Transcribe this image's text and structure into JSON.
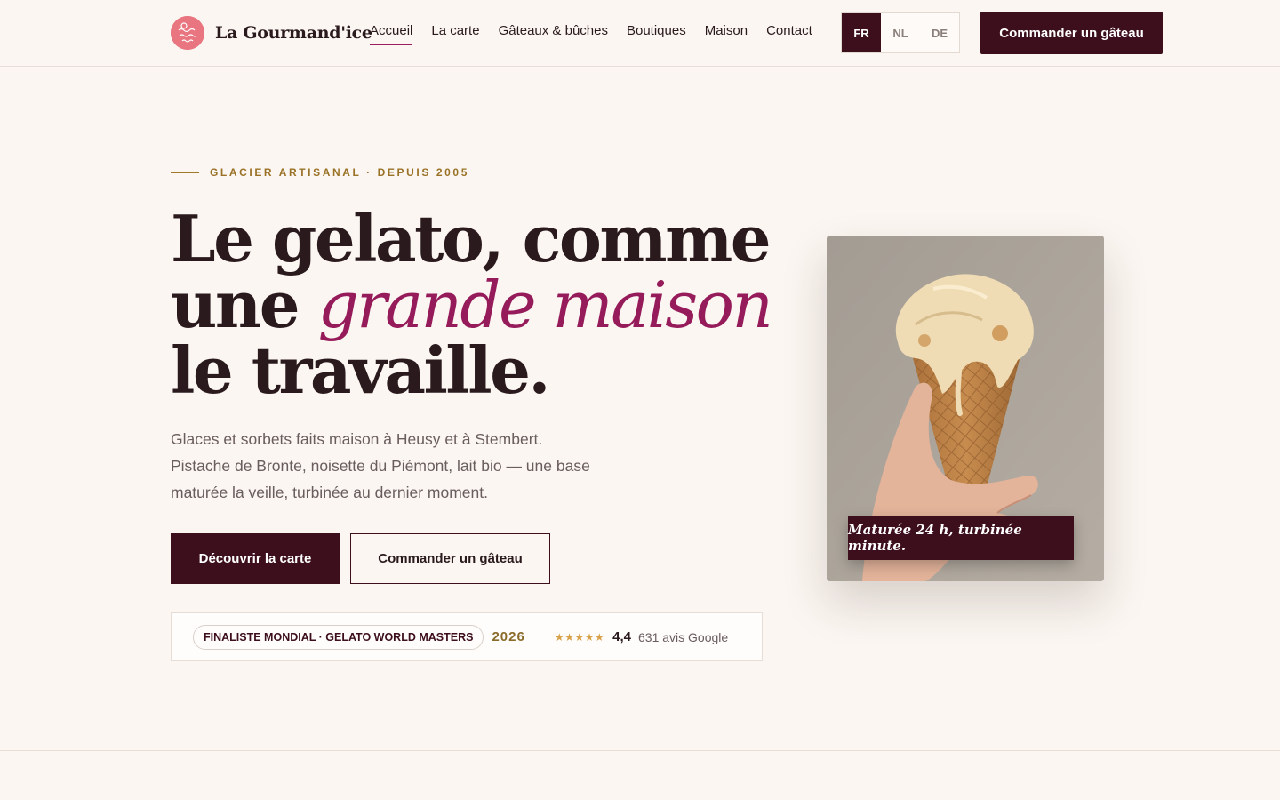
{
  "brand": {
    "name": "La Gourmand'ice",
    "logo_text": "Gourmand ice",
    "colors": {
      "primary": "#3d0f1c",
      "accent": "#961b5a",
      "gold": "#9a7227",
      "background": "#fbf6f1",
      "logo": "#e8757f"
    }
  },
  "nav": {
    "items": [
      {
        "label": "Accueil",
        "active": true
      },
      {
        "label": "La carte"
      },
      {
        "label": "Gâteaux & bûches"
      },
      {
        "label": "Boutiques"
      },
      {
        "label": "Maison"
      },
      {
        "label": "Contact"
      }
    ]
  },
  "lang": {
    "options": [
      "FR",
      "NL",
      "DE"
    ],
    "selected": "FR"
  },
  "header_cta": "Commander un gâteau",
  "hero": {
    "eyebrow": "GLACIER ARTISANAL · DEPUIS 2005",
    "headline_part1": "Le gelato, comme une ",
    "headline_accent": "grande maison",
    "headline_part2": " le travaille.",
    "lede": "Glaces et sorbets faits maison à Heusy et à Stembert. Pistache de Bronte, noisette du Piémont, lait bio — une base maturée la veille, turbinée au dernier moment.",
    "primary_cta": "Découvrir la carte",
    "secondary_cta": "Commander un gâteau"
  },
  "proof": {
    "badge": "FINALISTE MONDIAL · GELATO WORLD MASTERS",
    "year": "2026",
    "stars": "★★★★★",
    "star_rating": 4.4,
    "rating": "4,4",
    "reviews": "631 avis Google"
  },
  "photo": {
    "caption": "Maturée 24 h, turbinée minute.",
    "subject": "ice cream cone held in hand"
  }
}
